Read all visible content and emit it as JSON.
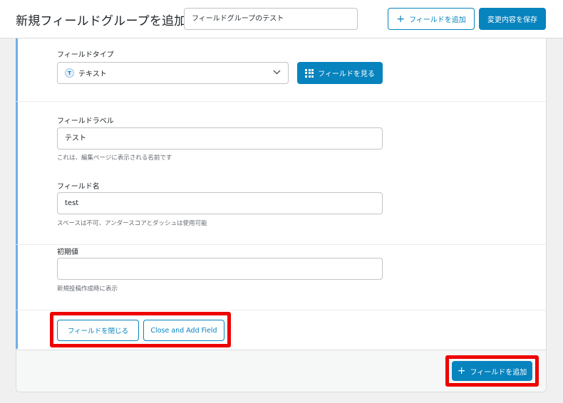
{
  "header": {
    "title": "新規フィールドグループを追加",
    "group_name_value": "フィールドグループのテスト",
    "add_field_label": "フィールドを追加",
    "save_label": "変更内容を保存"
  },
  "field_type": {
    "label": "フィールドタイプ",
    "selected": "テキスト",
    "icon_letter": "T",
    "browse_label": "フィールドを見る"
  },
  "field_label": {
    "label": "フィールドラベル",
    "value": "テスト",
    "hint": "これは、編集ページに表示される名前です"
  },
  "field_name": {
    "label": "フィールド名",
    "value": "test",
    "hint": "スペースは不可、アンダースコアとダッシュは使用可能"
  },
  "default_value": {
    "label": "初期値",
    "value": "",
    "hint": "新規投稿作成時に表示"
  },
  "actions": {
    "close_field_label": "フィールドを閉じる",
    "close_add_label": "Close and Add Field"
  },
  "footer": {
    "add_field_label": "フィールドを追加"
  },
  "colors": {
    "accent": "#0783be",
    "highlight": "#ee0000",
    "left_bar": "#72aee6"
  }
}
